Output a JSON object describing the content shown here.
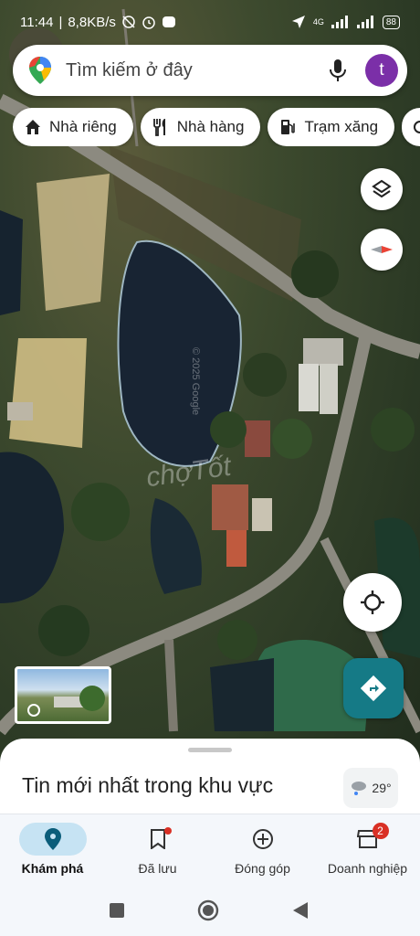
{
  "status_bar": {
    "time": "11:44",
    "speed": "8,8KB/s",
    "network": "4G",
    "battery": "88"
  },
  "search": {
    "placeholder": "Tìm kiếm ở đây",
    "avatar_letter": "t"
  },
  "chips": [
    {
      "label": "Nhà riêng",
      "icon": "home-icon"
    },
    {
      "label": "Nhà hàng",
      "icon": "restaurant-icon"
    },
    {
      "label": "Trạm xăng",
      "icon": "gas-station-icon"
    }
  ],
  "map": {
    "watermark": "chợTốt",
    "google_credit": "© 2025 Google"
  },
  "sheet": {
    "title": "Tin mới nhất trong khu vực",
    "weather_temp": "29°"
  },
  "nav": {
    "items": [
      {
        "label": "Khám phá",
        "active": true
      },
      {
        "label": "Đã lưu",
        "dot": true
      },
      {
        "label": "Đóng góp"
      },
      {
        "label": "Doanh nghiệp",
        "count": "2"
      }
    ]
  },
  "colors": {
    "accent": "#157a86",
    "avatar": "#7b2fa8",
    "active_pill": "#c6e3f3",
    "badge": "#d93025"
  }
}
